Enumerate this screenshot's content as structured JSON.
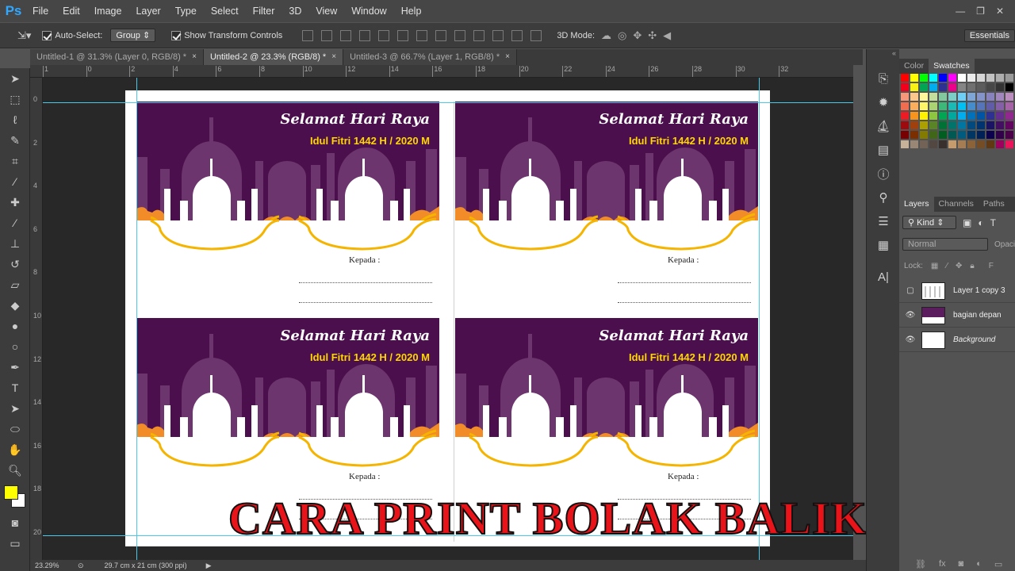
{
  "app": {
    "logo": "Ps"
  },
  "menu": [
    "File",
    "Edit",
    "Image",
    "Layer",
    "Type",
    "Select",
    "Filter",
    "3D",
    "View",
    "Window",
    "Help"
  ],
  "options": {
    "auto_select_label": "Auto-Select:",
    "auto_select_value": "Group",
    "show_transform_label": "Show Transform Controls",
    "mode_label": "3D Mode:",
    "workspace": "Essentials"
  },
  "tabs": [
    {
      "label": "Untitled-1 @ 31.3% (Layer 0, RGB/8) *",
      "active": false
    },
    {
      "label": "Untitled-2 @ 23.3% (RGB/8) *",
      "active": true
    },
    {
      "label": "Untitled-3 @ 66.7% (Layer 1, RGB/8) *",
      "active": false
    }
  ],
  "tab_close_glyph": "×",
  "ruler": {
    "top": [
      "1",
      "0",
      "2",
      "4",
      "6",
      "8",
      "10",
      "12",
      "14",
      "16",
      "18",
      "20",
      "22",
      "24",
      "26",
      "28",
      "30",
      "32"
    ],
    "left": [
      "0",
      "2",
      "4",
      "6",
      "8",
      "10",
      "12",
      "14",
      "16",
      "18",
      "20",
      "0"
    ]
  },
  "cards": {
    "greeting": "Selamat Hari Raya",
    "subtitle": "Idul Fitri 1442 H / 2020 M",
    "to_label": "Kepada :",
    "colors": {
      "purple_dark": "#4a0f4c",
      "purple_mid": "#6c356d",
      "gold": "#f4b400",
      "orange": "#f28c28",
      "text_yellow": "#ffd700"
    }
  },
  "overlay_title": "CARA PRINT BOLAK BALIK",
  "status": {
    "zoom": "23.29%",
    "doc_size": "29.7 cm x 21 cm (300 ppi)"
  },
  "panels": {
    "top_tabs": [
      "Color",
      "Swatches"
    ],
    "active_top": "Swatches",
    "layer_tabs": [
      "Layers",
      "Channels",
      "Paths"
    ],
    "active_layer_tab": "Layers",
    "kind_label": "Kind",
    "blend_mode": "Normal",
    "opacity_label": "Opaci",
    "lock_label": "Lock:",
    "fill_label": "F",
    "layers": [
      {
        "name": "Layer 1 copy 3",
        "visible": false
      },
      {
        "name": "bagian depan",
        "visible": true
      },
      {
        "name": "Background",
        "visible": true,
        "italic": true
      }
    ]
  },
  "colors": {
    "fg": "#ffff00",
    "bg": "#ffffff",
    "guide": "#4cc9e6",
    "overlay_red": "#e8141a"
  }
}
